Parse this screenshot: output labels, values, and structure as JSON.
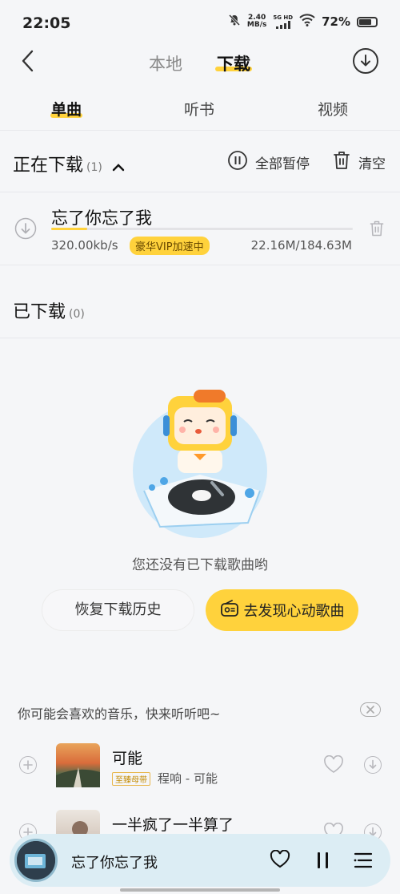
{
  "status_bar": {
    "time": "22:05",
    "net_speed_value": "2.40",
    "net_speed_unit": "MB/s",
    "network": "5G HD",
    "battery": "72%"
  },
  "header": {
    "tab_local": "本地",
    "tab_download": "下载"
  },
  "sub_tabs": [
    "单曲",
    "听书",
    "视频"
  ],
  "downloading": {
    "title": "正在下载",
    "count": "(1)",
    "pause_all": "全部暂停",
    "clear": "清空",
    "item": {
      "title": "忘了你忘了我",
      "speed": "320.00kb/s",
      "vip_badge": "豪华VIP加速中",
      "size": "22.16M/184.63M",
      "progress": 0.12
    }
  },
  "downloaded": {
    "title": "已下载",
    "count": "(0)",
    "empty_text": "您还没有已下载歌曲哟",
    "restore_button": "恢复下载历史",
    "discover_button": "去发现心动歌曲"
  },
  "recommend": {
    "title": "你可能会喜欢的音乐，快来听听吧~",
    "items": [
      {
        "name": "可能",
        "tag": "至臻母带",
        "artist": "程响 - 可能"
      },
      {
        "name": "一半疯了一半算了",
        "tag": "",
        "artist": ""
      }
    ]
  },
  "player": {
    "title": "忘了你忘了我"
  },
  "colors": {
    "accent": "#ffd23c",
    "background": "#f5f6f8",
    "player_bg": "#dcedf4"
  }
}
